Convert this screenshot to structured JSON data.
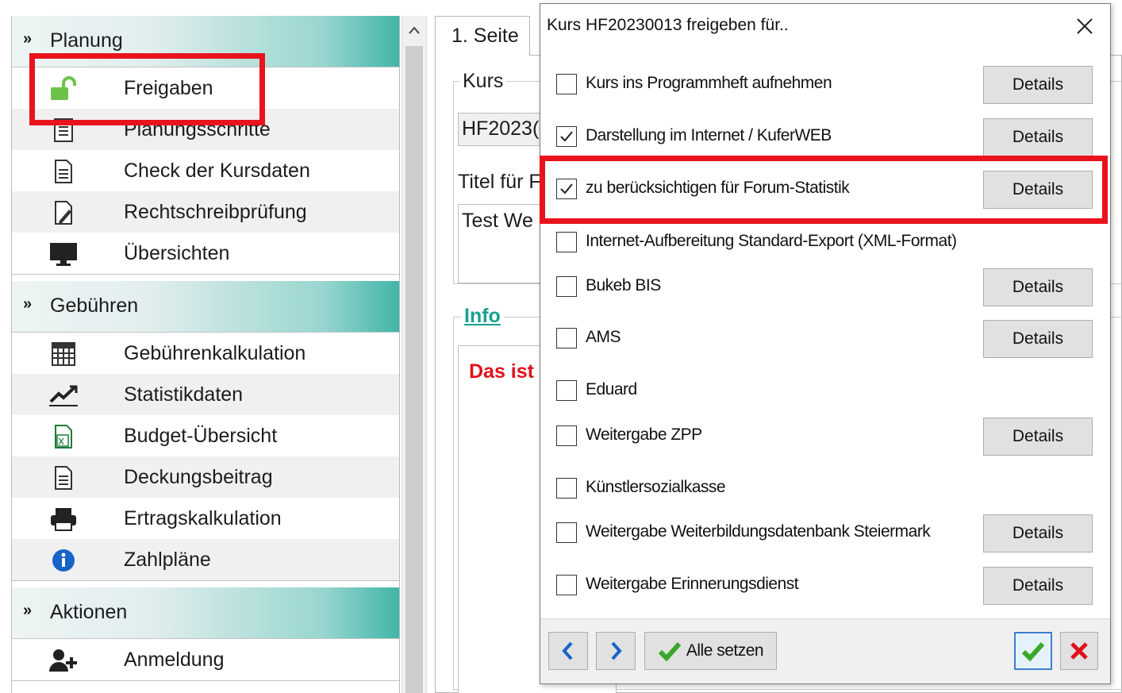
{
  "nav": {
    "groups": [
      {
        "title": "Planung",
        "items": [
          {
            "label": "Freigaben",
            "icon": "unlock-icon"
          },
          {
            "label": "Planungsschritte",
            "icon": "list-document-icon"
          },
          {
            "label": "Check der Kursdaten",
            "icon": "document-icon"
          },
          {
            "label": "Rechtschreibprüfung",
            "icon": "document-edit-icon"
          },
          {
            "label": "Übersichten",
            "icon": "monitor-icon"
          }
        ]
      },
      {
        "title": "Gebühren",
        "items": [
          {
            "label": "Gebührenkalkulation",
            "icon": "calculator-icon"
          },
          {
            "label": "Statistikdaten",
            "icon": "trend-chart-icon"
          },
          {
            "label": "Budget-Übersicht",
            "icon": "excel-icon"
          },
          {
            "label": "Deckungsbeitrag",
            "icon": "document-icon"
          },
          {
            "label": "Ertragskalkulation",
            "icon": "printer-icon"
          },
          {
            "label": "Zahlpläne",
            "icon": "info-icon"
          }
        ]
      },
      {
        "title": "Aktionen",
        "items": [
          {
            "label": "Anmeldung",
            "icon": "add-user-icon"
          }
        ]
      }
    ]
  },
  "form": {
    "tab": "1. Seite",
    "kurs_label": "Kurs",
    "kurs_value": "HF2023(",
    "titel_label": "Titel für F",
    "titel_value": "Test We",
    "info_label": "Info",
    "info_text": "Das ist"
  },
  "dialog": {
    "title": "Kurs HF20230013 freigeben für..",
    "close": "✕",
    "options": [
      {
        "label": "Kurs ins Programmheft aufnehmen",
        "checked": false,
        "details": "Details"
      },
      {
        "label": "Darstellung im Internet / KuferWEB",
        "checked": true,
        "details": "Details"
      },
      {
        "label": "zu berücksichtigen für Forum-Statistik",
        "checked": true,
        "details": "Details"
      },
      {
        "label": "Internet-Aufbereitung Standard-Export (XML-Format)",
        "checked": false,
        "details": null
      },
      {
        "label": "Bukeb BIS",
        "checked": false,
        "details": "Details"
      },
      {
        "label": "AMS",
        "checked": false,
        "details": "Details"
      },
      {
        "label": "Eduard",
        "checked": false,
        "details": null
      },
      {
        "label": "Weitergabe ZPP",
        "checked": false,
        "details": "Details"
      },
      {
        "label": "Künstlersozialkasse",
        "checked": false,
        "details": null
      },
      {
        "label": "Weitergabe Weiterbildungsdatenbank Steiermark",
        "checked": false,
        "details": "Details"
      },
      {
        "label": "Weitergabe Erinnerungsdienst",
        "checked": false,
        "details": "Details"
      }
    ],
    "footer": {
      "prev": "‹",
      "next": "›",
      "set_all": "Alle setzen"
    }
  },
  "colors": {
    "accent_teal": "#3fb5a7",
    "highlight_red": "#e8131d",
    "ok_green": "#3aa82a",
    "cancel_red": "#e0101a",
    "nav_blue": "#1763c8"
  }
}
